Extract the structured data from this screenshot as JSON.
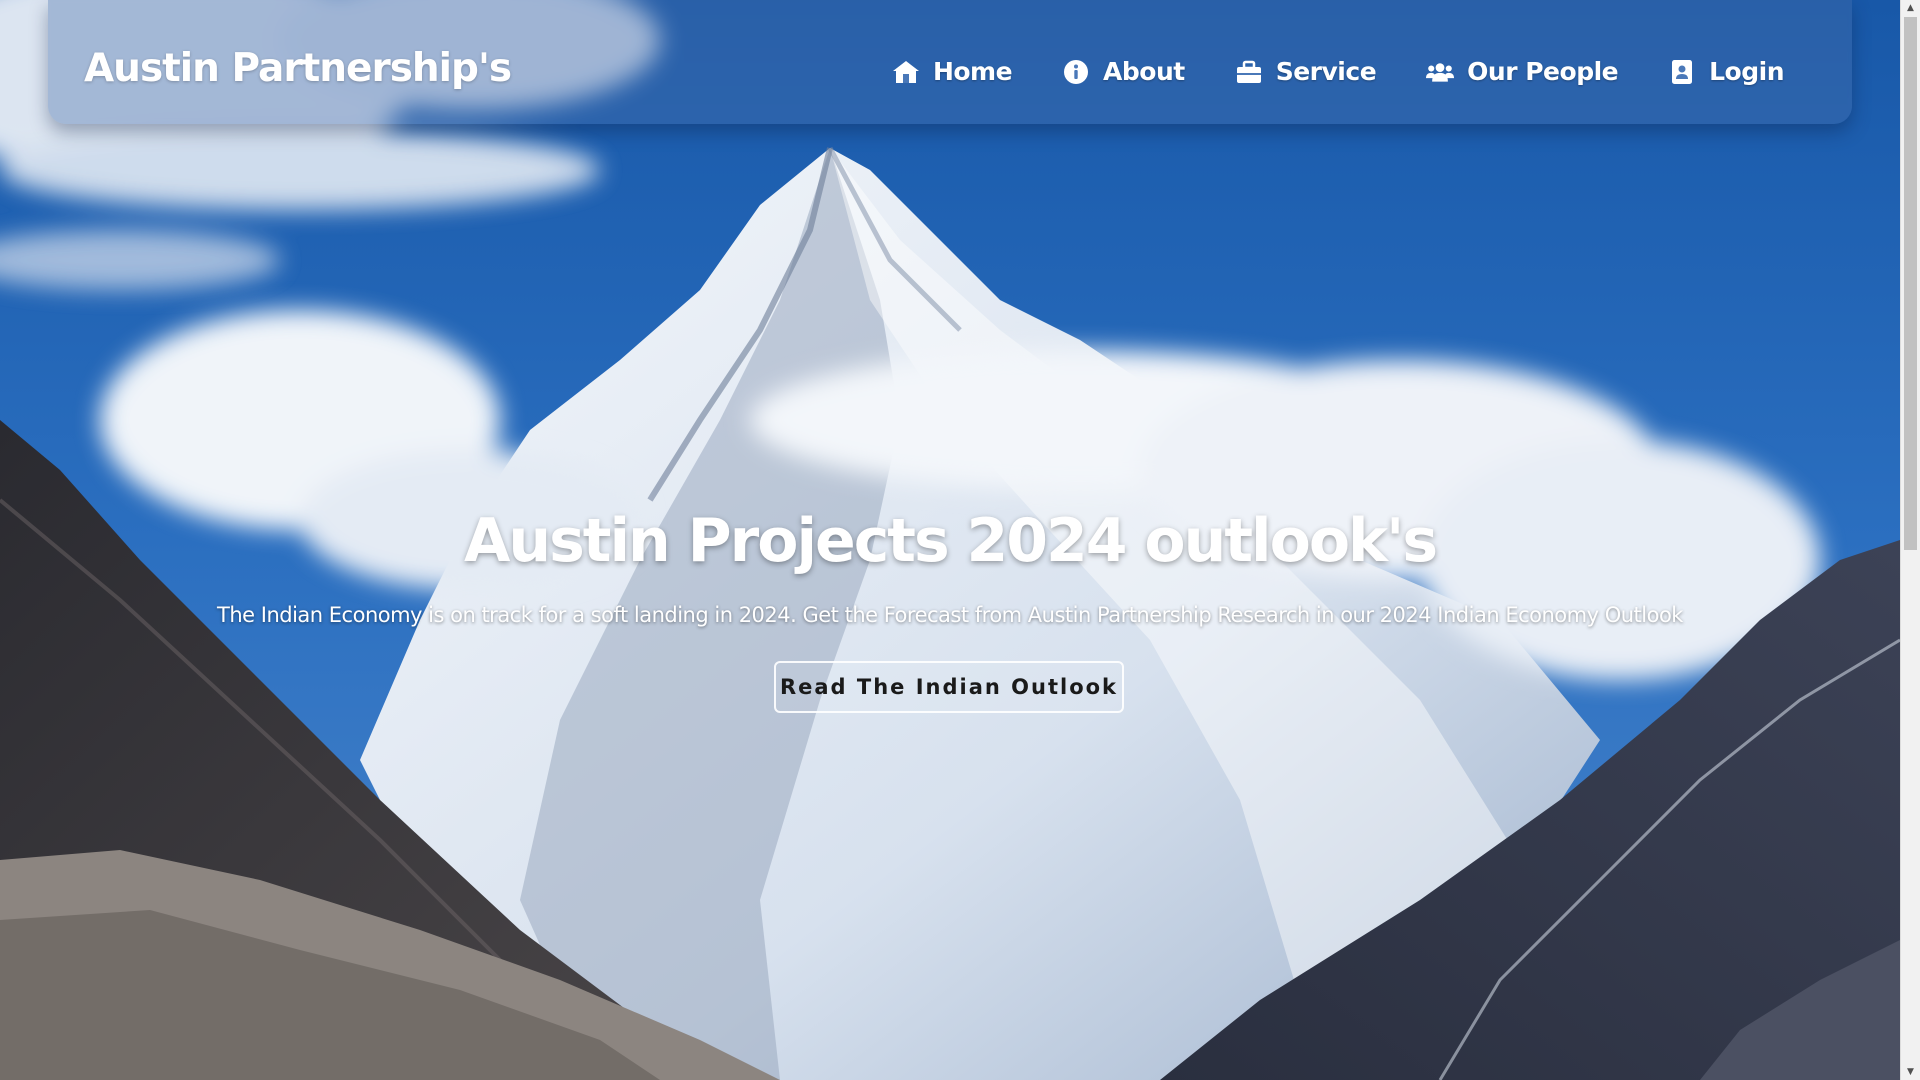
{
  "navbar": {
    "brand": "Austin Partnership's",
    "items": [
      {
        "label": "Home",
        "icon": "home-icon"
      },
      {
        "label": "About",
        "icon": "info-icon"
      },
      {
        "label": "Service",
        "icon": "briefcase-icon"
      },
      {
        "label": "Our People",
        "icon": "users-icon"
      },
      {
        "label": "Login",
        "icon": "id-card-icon"
      }
    ]
  },
  "hero": {
    "title": "Austin Projects 2024 outlook's",
    "subtitle": "The Indian Economy is on track for a soft landing in 2024. Get the Forecast from Austin Partnership Research in our 2024 Indian Economy Outlook",
    "cta_label": "Read The Indian Outlook"
  },
  "theme": {
    "sky": "#1f5fae",
    "text": "#ffffff",
    "cta_text": "#1a1a1a"
  }
}
